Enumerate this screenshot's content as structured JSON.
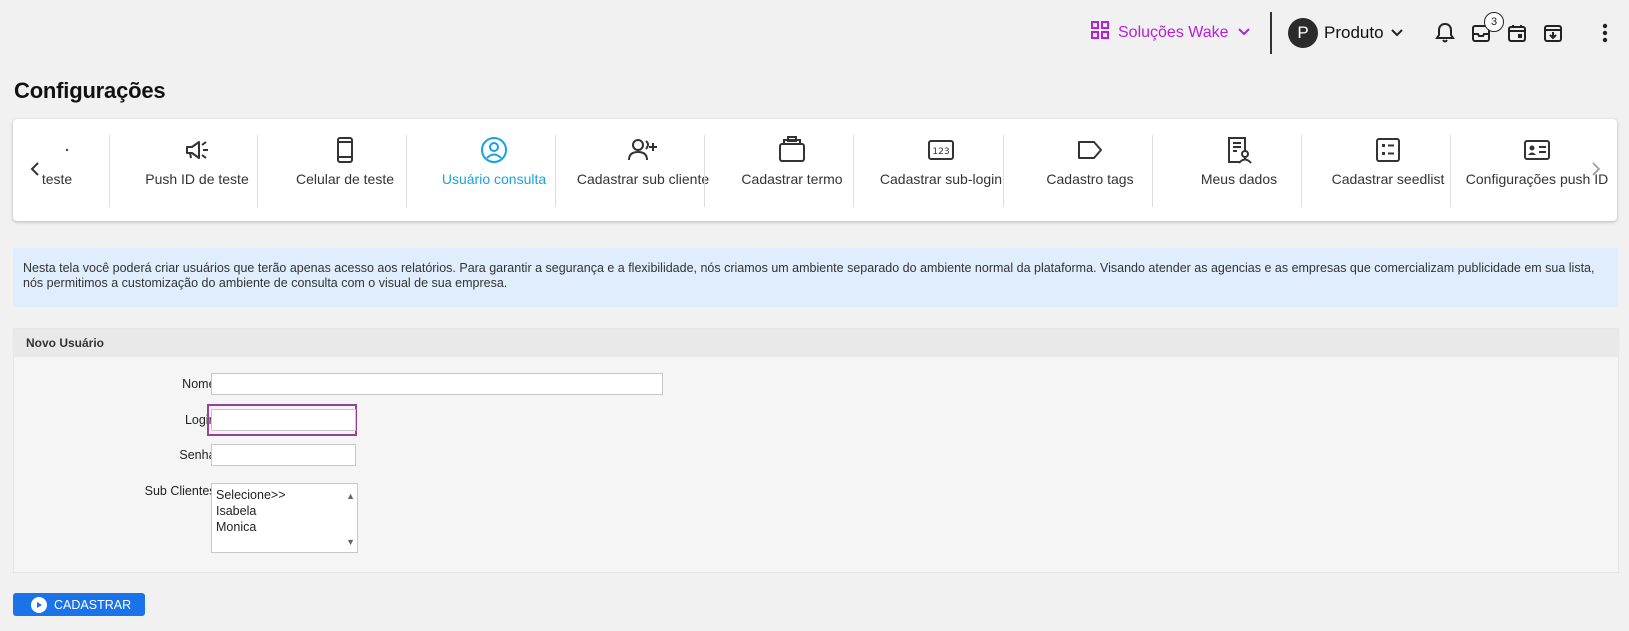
{
  "header": {
    "solucoes_label": "Soluções Wake",
    "avatar_initial": "P",
    "produto_label": "Produto",
    "badge_count": "3",
    "accent_color": "#b81fd6"
  },
  "page": {
    "title": "Configurações"
  },
  "tabs": [
    {
      "label": "teste",
      "icon": "partial-icon"
    },
    {
      "label": "Push ID de teste",
      "icon": "megaphone-icon"
    },
    {
      "label": "Celular de teste",
      "icon": "phone-icon"
    },
    {
      "label": "Usuário consulta",
      "icon": "user-circle-icon",
      "active": true
    },
    {
      "label": "Cadastrar sub cliente",
      "icon": "add-user-icon"
    },
    {
      "label": "Cadastrar termo",
      "icon": "briefcase-icon"
    },
    {
      "label": "Cadastrar sub-login",
      "icon": "number-pad-icon"
    },
    {
      "label": "Cadastro tags",
      "icon": "tag-icon"
    },
    {
      "label": "Meus dados",
      "icon": "profile-doc-icon"
    },
    {
      "label": "Cadastrar seedlist",
      "icon": "list-icon"
    },
    {
      "label": "Configurações push ID",
      "icon": "id-card-icon"
    }
  ],
  "info_text": "Nesta tela você poderá criar usuários que terão apenas acesso aos relatórios. Para garantir a segurança e a flexibilidade, nós criamos um ambiente separado do ambiente normal da plataforma. Visando atender as agencias e as empresas que comercializam publicidade em sua lista, nós permitimos a customização do ambiente de consulta com o visual de sua empresa.",
  "form": {
    "title": "Novo Usuário",
    "nome_label": "Nome:",
    "nome_value": "",
    "login_label": "Login:",
    "login_value": "",
    "senha_label": "Senha:",
    "senha_value": "",
    "subclientes_label": "Sub Clientes:",
    "subclientes_options": [
      "Selecione>>",
      "Isabela",
      "Monica"
    ]
  },
  "submit_label": "CADASTRAR"
}
